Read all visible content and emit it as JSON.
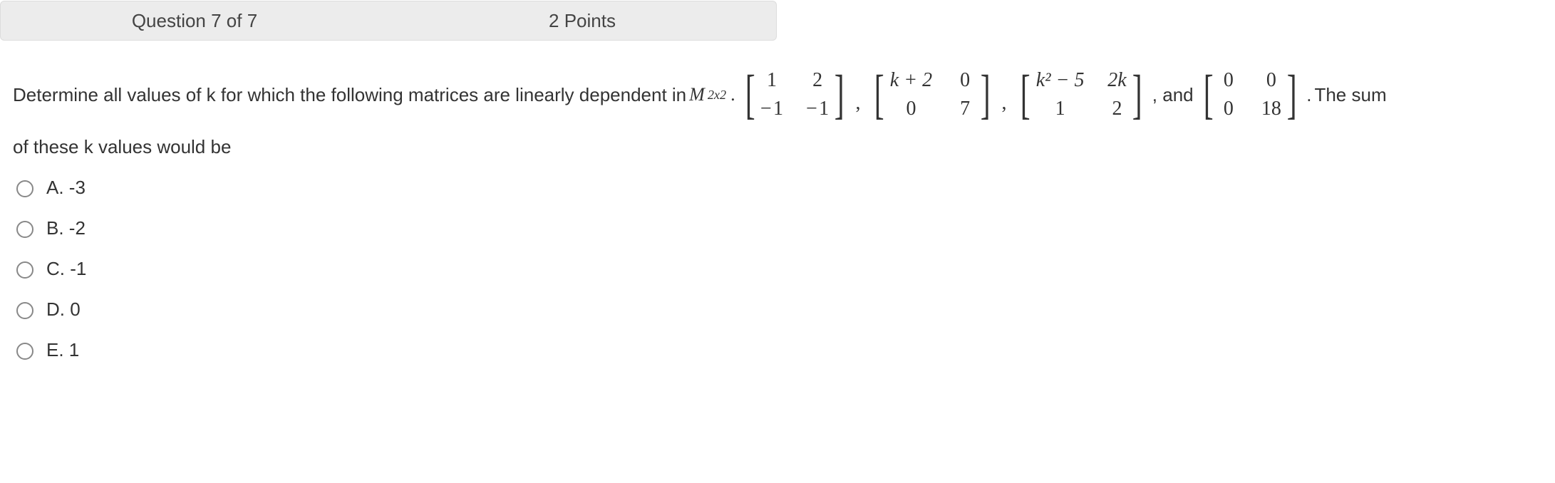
{
  "header": {
    "question_label": "Question 7 of 7",
    "points_label": "2 Points"
  },
  "question": {
    "line1_pre": "Determine all values of k for which the following matrices are linearly dependent in ",
    "space_symbol": "M",
    "space_sub": "2x2",
    "dot_after_space": ".",
    "matrix1": {
      "a11": "1",
      "a12": "2",
      "a21": "− 1",
      "a22": "− 1"
    },
    "matrix2": {
      "a11": "k + 2",
      "a12": "0",
      "a21": "0",
      "a22": "7"
    },
    "matrix3": {
      "a11": "k² − 5",
      "a12": "2k",
      "a21": "1",
      "a22": "2"
    },
    "and_word": ", and ",
    "matrix4": {
      "a11": "0",
      "a12": "0",
      "a21": "0",
      "a22": "18"
    },
    "period": ". ",
    "tail_text": "The sum",
    "line2": "of these k values would be",
    "comma": ","
  },
  "options": {
    "A": "A. -3",
    "B": "B. -2",
    "C": "C. -1",
    "D": "D. 0",
    "E": "E. 1"
  }
}
